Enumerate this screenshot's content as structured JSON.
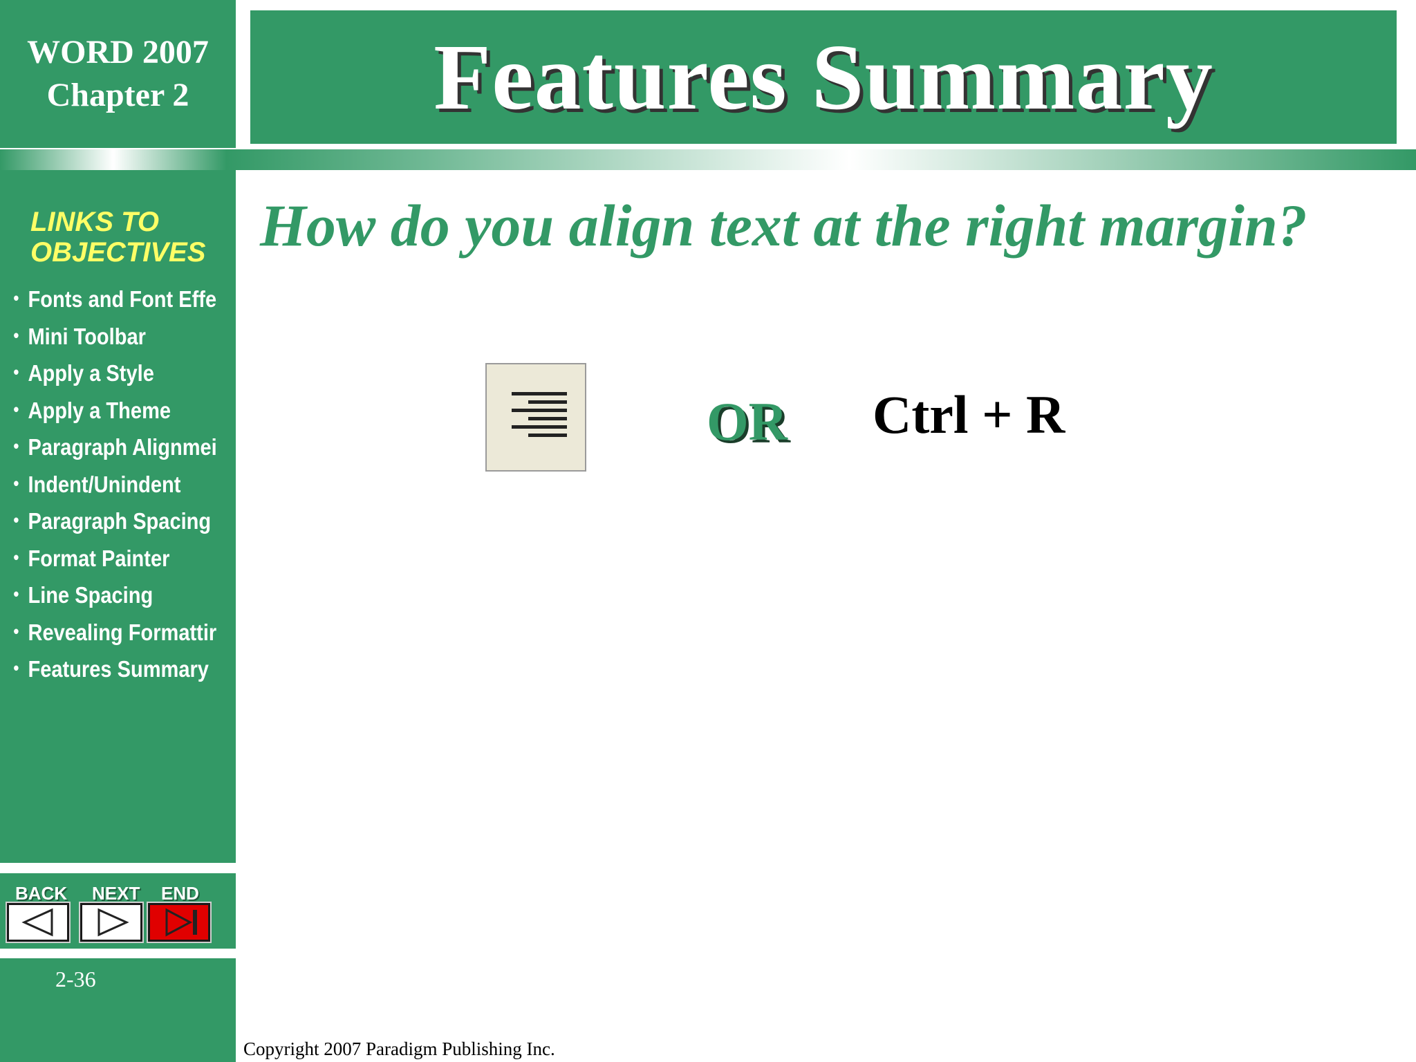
{
  "colors": {
    "primary_green": "#339966",
    "heading_yellow": "#ffff66",
    "end_red": "#e00000",
    "text_white": "#ffffff"
  },
  "header": {
    "course_line1": "WORD 2007",
    "course_line2": "Chapter 2",
    "title": "Features Summary"
  },
  "sidebar": {
    "heading_line1": "LINKS TO",
    "heading_line2": "OBJECTIVES",
    "links": [
      "Fonts and Font Effe",
      "Mini Toolbar",
      "Apply  a Style",
      "Apply a Theme",
      "Paragraph Alignmei",
      "Indent/Unindent",
      "Paragraph Spacing",
      "Format Painter",
      "Line Spacing",
      "Revealing Formattir",
      "Features Summary"
    ]
  },
  "navigation": {
    "back_label": "BACK",
    "next_label": "NEXT",
    "end_label": "END",
    "back_icon": "triangle-left-icon",
    "next_icon": "triangle-right-icon",
    "end_icon": "skip-to-end-icon"
  },
  "page_number": "2-36",
  "content": {
    "question": "How do you align text at the right margin?",
    "icon": "align-right-icon",
    "or_text": "OR",
    "shortcut": "Ctrl + R"
  },
  "footer": {
    "copyright": "Copyright 2007 Paradigm Publishing Inc."
  }
}
